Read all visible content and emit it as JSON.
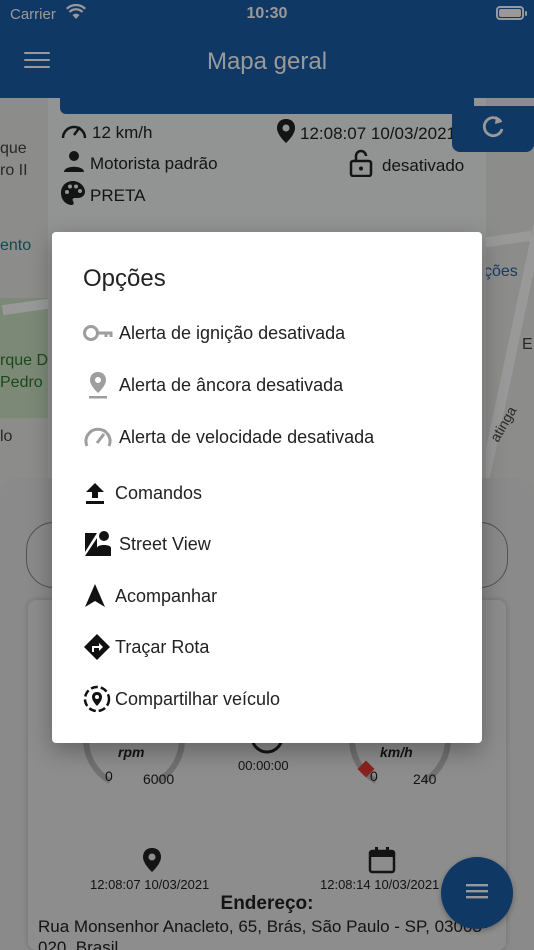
{
  "status": {
    "carrier": "Carrier",
    "time": "10:30"
  },
  "header": {
    "title": "Mapa geral"
  },
  "map": {
    "labels": [
      "que",
      "ro II",
      "ento",
      "rque D",
      "Pedro I",
      "lo",
      "ções",
      "E",
      "atinga"
    ]
  },
  "vehicle": {
    "speed": "12 km/h",
    "datetime": "12:08:07 10/03/2021",
    "driver": "Motorista padrão",
    "lock_status": "desativado",
    "color": "PRETA"
  },
  "gauges": {
    "rpm_label": "rpm",
    "rpm_min": "0",
    "rpm_max": "6000",
    "timer": "00:00:00",
    "speed_label": "km/h",
    "speed_min": "0",
    "speed_max": "240"
  },
  "details": {
    "last_position_time": "12:08:07 10/03/2021",
    "last_update_time": "12:08:14 10/03/2021",
    "address_title": "Endereço:",
    "address": "Rua Monsenhor Anacleto, 65, Brás, São Paulo - SP, 03003-020, Brasil"
  },
  "dialog": {
    "title": "Opções",
    "options": [
      {
        "label": "Alerta de ignição desativada",
        "icon": "key-icon"
      },
      {
        "label": "Alerta de âncora desativada",
        "icon": "location-pin-icon"
      },
      {
        "label": "Alerta de velocidade desativada",
        "icon": "speedometer-icon"
      },
      {
        "label": "Comandos",
        "icon": "upload-icon"
      },
      {
        "label": "Street View",
        "icon": "street-view-icon"
      },
      {
        "label": "Acompanhar",
        "icon": "navigation-arrow-icon"
      },
      {
        "label": "Traçar Rota",
        "icon": "directions-icon"
      },
      {
        "label": "Compartilhar veículo",
        "icon": "share-location-icon"
      }
    ]
  },
  "colors": {
    "primary": "#1a5ea8",
    "disabled_icon": "#9e9e9e",
    "text": "#222222"
  }
}
